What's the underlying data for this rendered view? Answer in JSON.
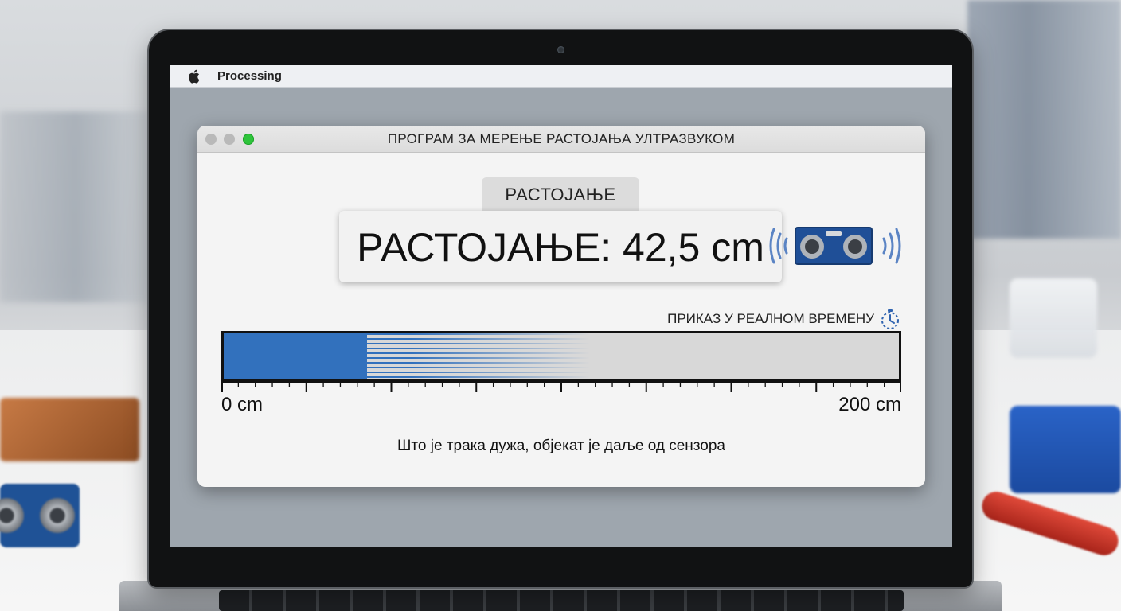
{
  "menu_bar": {
    "app_icon": "apple-icon",
    "app_name": "Processing"
  },
  "window": {
    "title": "ПРОГРАМ ЗА МЕРЕЊЕ РАСТОЈАЊА УЛТРАЗВУКОМ",
    "traffic_lights": [
      "close",
      "minimize",
      "maximize"
    ]
  },
  "display": {
    "tab_label": "РАСТОЈАЊЕ",
    "readout": "РАСТОЈАЊЕ: 42,5 cm",
    "sensor_icon": "ultrasonic-sensor-icon"
  },
  "realtime": {
    "label": "ПРИКАЗ У РЕАЛНОМ ВРЕМЕНУ",
    "icon": "stopwatch-icon"
  },
  "distance_bar": {
    "value": 42.5,
    "min": 0,
    "max": 200,
    "unit": "cm",
    "min_label": "0 cm",
    "max_label": "200 cm",
    "fill_color": "#3271bd"
  },
  "hint": "Што је трака дужа, објекат је даље од сензора"
}
